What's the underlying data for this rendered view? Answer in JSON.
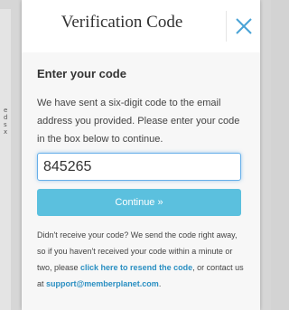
{
  "background": {
    "edge_text": "e d s x"
  },
  "modal": {
    "title": "Verification Code",
    "close_icon": "close-x-icon",
    "heading": "Enter your code",
    "description": "We have sent a six-digit code to the email address you provided. Please enter your code in the box below to continue.",
    "code_input": {
      "value": "845265",
      "placeholder": ""
    },
    "continue_label": "Continue »",
    "help": {
      "text_before": "Didn't receive your code? We send the code right away, so if you haven't received your code within a minute or two, please ",
      "resend_link": "click here to resend the code",
      "text_middle": ", or contact us at ",
      "support_email": "support@memberplanet.com",
      "text_after": "."
    }
  },
  "colors": {
    "accent": "#5bc0de",
    "link": "#2a8fc2",
    "close_icon": "#4aa3d6",
    "input_focus": "#66afe9"
  }
}
